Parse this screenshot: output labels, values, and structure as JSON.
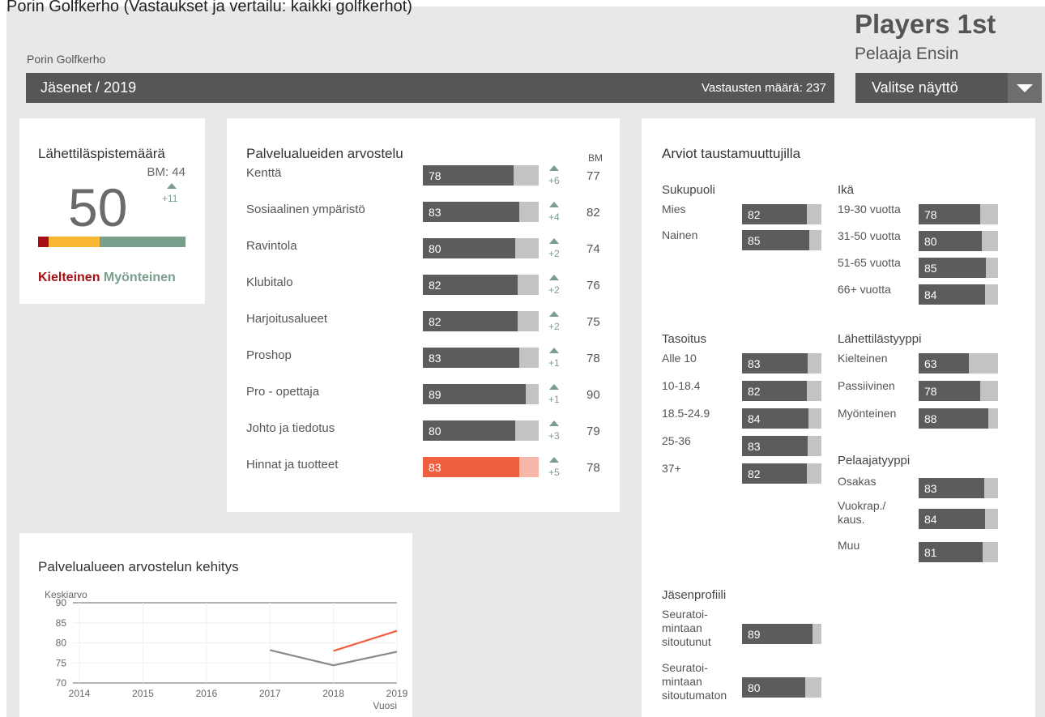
{
  "top_cut_text": "Porin Golfkerho (Vastaukset ja vertailu: kaikki golfkerhot)",
  "club_name": "Porin Golfkerho",
  "brand": {
    "title": "Players 1st",
    "subtitle": "Pelaaja Ensin"
  },
  "header": {
    "title": "Jäsenet / 2019",
    "count": "Vastausten määrä: 237"
  },
  "select": {
    "label": "Valitse näyttö"
  },
  "ambassador": {
    "title": "Lähettiläspistemäärä",
    "bm": "BM: 44",
    "score": "50",
    "delta": "+11",
    "segments": [
      {
        "pct": 7,
        "color": "#a80d14"
      },
      {
        "pct": 35,
        "color": "#f9b734"
      },
      {
        "pct": 58,
        "color": "#7a9e8c"
      }
    ],
    "label_negative": "Kielteinen",
    "label_positive": "Myönteinen"
  },
  "service": {
    "title": "Palvelualueiden arvostelu",
    "bm_header": "BM",
    "items": [
      {
        "label": "Kenttä",
        "value": 78,
        "delta": "+6",
        "bm": 77
      },
      {
        "label": "Sosiaalinen ympäristö",
        "value": 83,
        "delta": "+4",
        "bm": 82
      },
      {
        "label": "Ravintola",
        "value": 80,
        "delta": "+2",
        "bm": 74
      },
      {
        "label": "Klubitalo",
        "value": 82,
        "delta": "+2",
        "bm": 76
      },
      {
        "label": "Harjoitusalueet",
        "value": 82,
        "delta": "+2",
        "bm": 75
      },
      {
        "label": "Proshop",
        "value": 83,
        "delta": "+1",
        "bm": 78
      },
      {
        "label": "Pro - opettaja",
        "value": 89,
        "delta": "+1",
        "bm": 90
      },
      {
        "label": "Johto ja tiedotus",
        "value": 80,
        "delta": "+3",
        "bm": 79
      },
      {
        "label": "Hinnat ja tuotteet",
        "value": 83,
        "delta": "+5",
        "bm": 78,
        "highlight": true
      }
    ]
  },
  "background": {
    "title": "Arviot taustamuuttujilla",
    "groups": {
      "sukupuoli": {
        "title": "Sukupuoli",
        "items": [
          {
            "label": "Mies",
            "value": 82
          },
          {
            "label": "Nainen",
            "value": 85
          }
        ]
      },
      "ika": {
        "title": "Ikä",
        "items": [
          {
            "label": "19-30 vuotta",
            "value": 78
          },
          {
            "label": "31-50 vuotta",
            "value": 80
          },
          {
            "label": "51-65 vuotta",
            "value": 85
          },
          {
            "label": "66+ vuotta",
            "value": 84
          }
        ]
      },
      "tasoitus": {
        "title": "Tasoitus",
        "items": [
          {
            "label": "Alle 10",
            "value": 83
          },
          {
            "label": "10-18.4",
            "value": 82
          },
          {
            "label": "18.5-24.9",
            "value": 84
          },
          {
            "label": "25-36",
            "value": 83
          },
          {
            "label": "37+",
            "value": 82
          }
        ]
      },
      "lahettilas": {
        "title": "Lähettilästyyppi",
        "items": [
          {
            "label": "Kielteinen",
            "value": 63
          },
          {
            "label": "Passiivinen",
            "value": 78
          },
          {
            "label": "Myönteinen",
            "value": 88
          }
        ]
      },
      "pelaaja": {
        "title": "Pelaajatyyppi",
        "items": [
          {
            "label": "Osakas",
            "value": 83
          },
          {
            "label": "Vuokrap./\nkaus.",
            "value": 84
          },
          {
            "label": "Muu",
            "value": 81
          }
        ]
      },
      "jasen": {
        "title": "Jäsenprofiili",
        "items": [
          {
            "label": "Seuratoi-\nmintaan\nsitoutunut",
            "value": 89
          },
          {
            "label": "Seuratoi-\nmintaan\nsitoutumaton",
            "value": 80
          }
        ]
      }
    }
  },
  "trend": {
    "title": "Palvelualueen arvostelun kehitys"
  },
  "chart_data": {
    "type": "line",
    "ylabel": "Keskiarvo",
    "xlabel": "Vuosi",
    "x": [
      2014,
      2015,
      2016,
      2017,
      2018,
      2019
    ],
    "ylim": [
      70,
      90
    ],
    "yticks": [
      70,
      75,
      80,
      85,
      90
    ],
    "series": [
      {
        "color": "#8a8a8a",
        "points": [
          [
            2017,
            78.2
          ],
          [
            2018,
            74.4
          ],
          [
            2019,
            77.8
          ]
        ]
      },
      {
        "color": "#f15f41",
        "points": [
          [
            2018,
            78
          ],
          [
            2019,
            83
          ]
        ]
      }
    ]
  }
}
